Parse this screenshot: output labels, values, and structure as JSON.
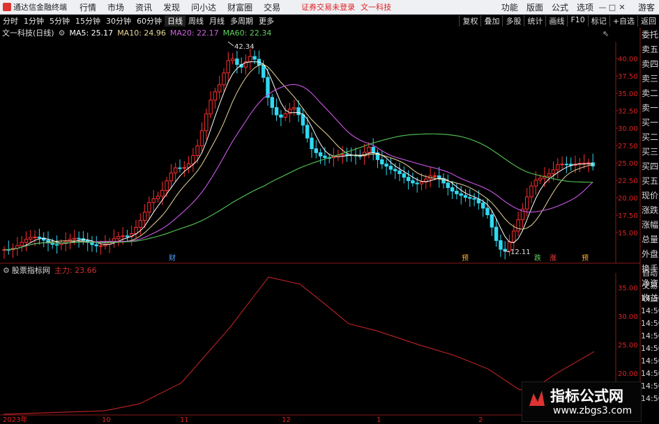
{
  "menubar": {
    "app_title": "通达信金融终端",
    "items": [
      "行情",
      "市场",
      "资讯",
      "发现",
      "问小达",
      "财富圈",
      "交易"
    ],
    "status": "证券交易未登录",
    "stock_name": "文一科技",
    "right_items": [
      "功能",
      "版面",
      "公式",
      "选项"
    ],
    "guest": "游客",
    "win": [
      "—",
      "□",
      "✕"
    ]
  },
  "toolbar": {
    "periods": [
      "分时",
      "1分钟",
      "5分钟",
      "15分钟",
      "30分钟",
      "60分钟",
      "日线",
      "周线",
      "月线",
      "多周期",
      "更多"
    ],
    "active": "日线",
    "buttons": [
      "复权",
      "叠加",
      "多股",
      "统计",
      "画线",
      "F10",
      "标记",
      "+自选",
      "返回"
    ]
  },
  "infobar": {
    "title": "文一科技(日线)",
    "ma5": "MA5: 25.17",
    "ma10": "MA10: 24.96",
    "ma20": "MA20: 22.17",
    "ma60": "MA60: 22.34",
    "colors": {
      "ma5": "#ffffff",
      "ma10": "#e8d89a",
      "ma20": "#d060e0",
      "ma60": "#60d060"
    }
  },
  "side_panel": {
    "items": [
      "委托",
      "卖五",
      "卖四",
      "卖三",
      "卖二",
      "卖一",
      "买一",
      "买二",
      "买三",
      "买四",
      "买五",
      "现价",
      "涨跌",
      "涨幅",
      "总量",
      "外盘",
      "换手",
      "净资",
      "收益"
    ]
  },
  "side_panel2": {
    "items": [
      "自动",
      "交易",
      "14:50",
      "14:50",
      "14:50",
      "14:50",
      "14:50",
      "14:50",
      "14:50",
      "14:50",
      "14:50"
    ]
  },
  "price_axis": [
    "40.00",
    "37.50",
    "35.00",
    "32.50",
    "30.00",
    "27.50",
    "25.00",
    "22.50",
    "20.00",
    "17.50",
    "15.00"
  ],
  "annotations": {
    "high": "42.34",
    "low": "12.11"
  },
  "markers": [
    {
      "label": "财",
      "color": "#4fa3ff"
    },
    {
      "label": "预",
      "color": "#ffb030"
    },
    {
      "label": "跌",
      "color": "#60d060"
    },
    {
      "label": "涨",
      "color": "#ff4040"
    },
    {
      "label": "预",
      "color": "#ffb030"
    }
  ],
  "indicator": {
    "name": "股票指标网",
    "series_label": "主力: 23.66",
    "axis": [
      "35.00",
      "30.00",
      "25.00",
      "20.00"
    ]
  },
  "date_axis": [
    "2023年",
    "10",
    "11",
    "12",
    "1",
    "2"
  ],
  "watermark": {
    "line1": "指标公式网",
    "line2": "www.zbgs3.com"
  }
}
